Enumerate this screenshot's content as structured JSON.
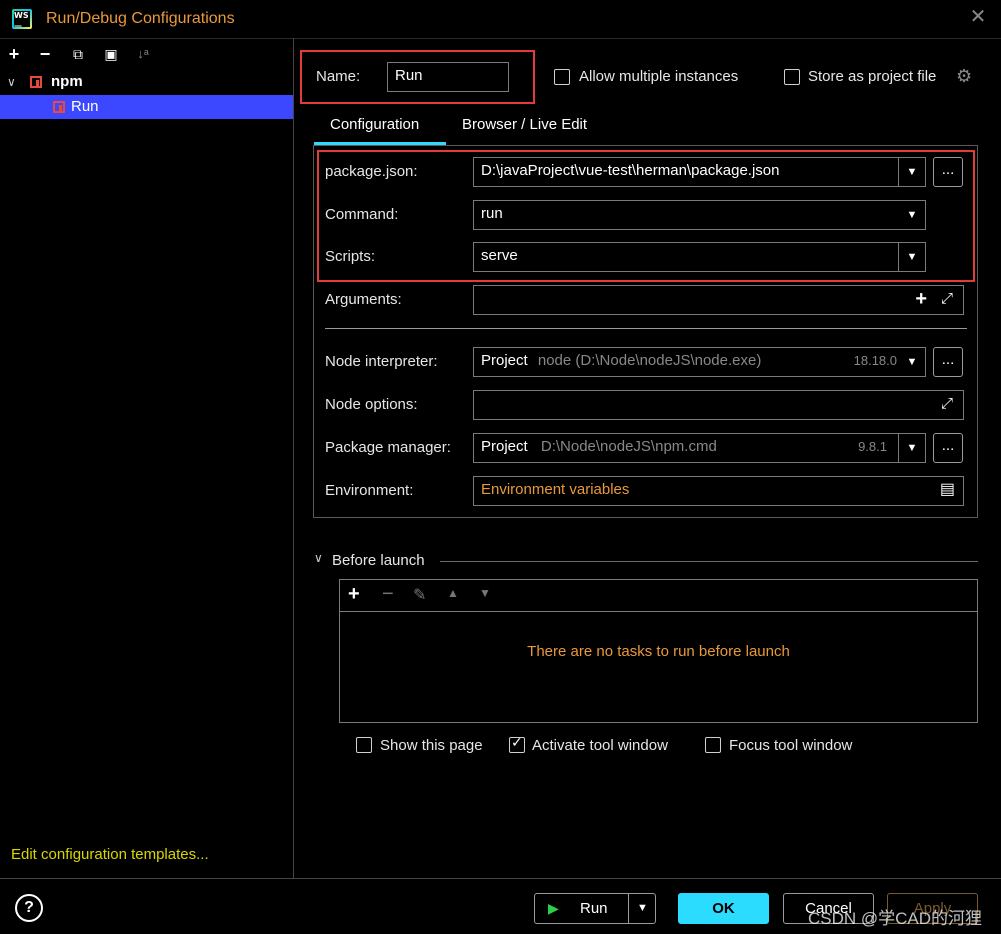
{
  "window": {
    "title": "Run/Debug Configurations",
    "close_symbol": "✕"
  },
  "left_toolbar": {
    "add": "+",
    "remove": "−",
    "copy": "⧉",
    "folder": "▣",
    "sort": "↓ᵃ"
  },
  "tree": {
    "group_label": "npm",
    "item_label": "Run"
  },
  "edit_templates": "Edit configuration templates...",
  "name": {
    "label": "Name:",
    "value": "Run"
  },
  "allow_multiple": {
    "label": "Allow multiple instances",
    "checked": false
  },
  "store_as_project": {
    "label": "Store as project file",
    "checked": false
  },
  "tabs": [
    "Configuration",
    "Browser / Live Edit"
  ],
  "config": {
    "package_json_label": "package.json:",
    "package_json_value": "D:\\javaProject\\vue-test\\herman\\package.json",
    "command_label": "Command:",
    "command_value": "run",
    "scripts_label": "Scripts:",
    "scripts_value": "serve",
    "arguments_label": "Arguments:",
    "arguments_value": "",
    "node_interpreter_label": "Node interpreter:",
    "node_interpreter_main": "Project",
    "node_interpreter_path": "node (D:\\Node\\nodeJS\\node.exe)",
    "node_interpreter_version": "18.18.0",
    "node_options_label": "Node options:",
    "node_options_value": "",
    "package_manager_label": "Package manager:",
    "package_manager_main": "Project",
    "package_manager_path": "D:\\Node\\nodeJS\\npm.cmd",
    "package_manager_version": "9.8.1",
    "environment_label": "Environment:",
    "environment_value": "Environment variables",
    "dots": "..."
  },
  "before_launch": {
    "title": "Before launch",
    "empty_text": "There are no tasks to run before launch"
  },
  "options": {
    "show_page": {
      "label": "Show this page",
      "checked": false
    },
    "activate_tool": {
      "label": "Activate tool window",
      "checked": true
    },
    "focus_tool": {
      "label": "Focus tool window",
      "checked": false
    }
  },
  "buttons": {
    "run": "Run",
    "ok": "OK",
    "cancel": "Cancel",
    "apply": "Apply"
  },
  "watermark": "CSDN @学CAD的河狸",
  "colors": {
    "accent": "#2bdcff",
    "selection": "#3b48ff",
    "highlight_box": "#e33b3b",
    "orange_text": "#e8993a"
  }
}
